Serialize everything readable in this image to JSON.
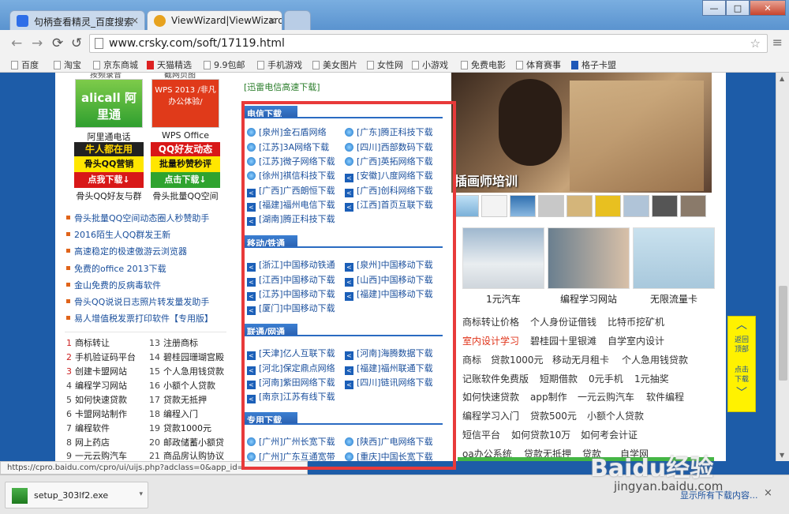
{
  "browser": {
    "tabs": [
      {
        "label": "句柄查看精灵_百度搜索",
        "active": false
      },
      {
        "label": "ViewWizard|ViewWizard",
        "active": true
      }
    ],
    "close_glyph": "×",
    "window_buttons": {
      "minimize": "—",
      "maximize": "□",
      "close": "✕"
    },
    "nav": {
      "back": "←",
      "forward": "→",
      "reload": "⟳",
      "stop": "↺"
    },
    "url": "www.crsky.com/soft/17119.html",
    "star_glyph": "☆",
    "menu_glyph": "≡",
    "bookmarks": [
      "百度",
      "淘宝",
      "京东商城",
      "天猫精选",
      "9.9包邮",
      "手机游戏",
      "美女图片",
      "女性网",
      "小游戏",
      "免费电影",
      "体育赛事",
      "格子卡盟"
    ]
  },
  "left": {
    "top_labels": [
      "按频录音",
      "截网页图"
    ],
    "apps": [
      {
        "img_text": "alicall 阿里通",
        "label": "阿里通电话"
      },
      {
        "img_text": "WPS 2013 /非凡办公体验/",
        "label": "WPS Office"
      },
      {
        "img_t1": "牛人都在用",
        "img_t2": "骨头QQ营销",
        "img_t3": "点我下载↓",
        "label": "骨头QQ好友与群"
      },
      {
        "img_t1": "QQ好友动态",
        "img_t2": "批量秒赞秒评",
        "img_t3": "点击下载↓",
        "label": "骨头批量QQ空间"
      }
    ],
    "links": [
      "骨头批量QQ空间动态圈人秒赞助手",
      "2016陌生人QQ群发王新",
      "高速稳定的极速傲游云浏览器",
      "免费的office 2013下载",
      "金山免费的反病毒软件",
      "骨头QQ说说日志照片转发量发助手",
      "易人增值税发票打印软件"
    ],
    "special_tag": "【专用版】",
    "ranks": [
      {
        "n": "1",
        "t": "商标转让"
      },
      {
        "n": "13",
        "t": "注册商标"
      },
      {
        "n": "2",
        "t": "手机验证码平台"
      },
      {
        "n": "14",
        "t": "碧桂园珊瑚宫殿"
      },
      {
        "n": "3",
        "t": "创建卡盟网站"
      },
      {
        "n": "15",
        "t": "个人急用钱贷款"
      },
      {
        "n": "4",
        "t": "编程学习网站"
      },
      {
        "n": "16",
        "t": "小额个人贷款"
      },
      {
        "n": "5",
        "t": "如何快速贷款"
      },
      {
        "n": "17",
        "t": "贷款无抵押"
      },
      {
        "n": "6",
        "t": "卡盟网站制作"
      },
      {
        "n": "18",
        "t": "编程入门"
      },
      {
        "n": "7",
        "t": "编程软件"
      },
      {
        "n": "19",
        "t": "贷款1000元"
      },
      {
        "n": "8",
        "t": "网上药店"
      },
      {
        "n": "20",
        "t": "邮政储蓄小额贷"
      },
      {
        "n": "9",
        "t": "一元云购汽车"
      },
      {
        "n": "21",
        "t": "商品房认购协议"
      }
    ]
  },
  "middle": {
    "top_link": "[迅雷电信高速下载]",
    "sections": [
      {
        "title": "电信下载",
        "links": [
          "[泉州]金石盾网络",
          "[广东]腾正科技下载",
          "[江苏]3A网络下载",
          "[四川]西部数码下载",
          "[江苏]微子网络下载",
          "[广西]英拓网络下载",
          "[徐州]祺信科技下载",
          "[安徽]八度网络下载",
          "[广西]广西朗恒下载",
          "[广西]创科网络下载",
          "[福建]福州电信下载",
          "[江西]首页互联下载",
          "[湖南]腾正科技下载"
        ]
      },
      {
        "title": "移动/铁通",
        "links": [
          "[浙江]中国移动铁通",
          "[泉州]中国移动下载",
          "[江西]中国移动下载",
          "[山西]中国移动下载",
          "[江苏]中国移动下载",
          "[福建]中国移动下载",
          "[厦门]中国移动下载"
        ]
      },
      {
        "title": "联通/网通",
        "links": [
          "[天津]亿人互联下载",
          "[河南]海腾数据下载",
          "[河北]保定鼎点网络",
          "[福建]福州联通下载",
          "[河南]紫田网络下载",
          "[四川]链讯网络下载",
          "[南京]江苏有线下载"
        ]
      },
      {
        "title": "专用下载",
        "links": [
          "[广州]广州长宽下载",
          "[陕西]广电网络下载",
          "[广州]广东互通宽带",
          "[重庆]中国长宽下载"
        ]
      }
    ],
    "bottom_label": "下载"
  },
  "right": {
    "photo_caption": "插画师培训",
    "cards": [
      "1元汽车",
      "编程学习网站",
      "无限流量卡"
    ],
    "keywords": [
      [
        "商标转让价格",
        "个人身份证借钱",
        "比特币挖矿机"
      ],
      [
        "室内设计学习",
        "碧桂园十里银滩",
        "自学室内设计"
      ],
      [
        "商标",
        "贷款1000元",
        "移动无月租卡",
        "个人急用钱贷款"
      ],
      [
        "记账软件免费版",
        "短期借款",
        "0元手机",
        "1元抽奖"
      ],
      [
        "如何快速贷款",
        "app制作",
        "一元云购汽车",
        "软件编程"
      ],
      [
        "编程学习入门",
        "贷款500元",
        "小额个人贷款"
      ],
      [
        "短信平台",
        "如何贷款10万",
        "如何考会计证"
      ],
      [
        "oa办公系统",
        "贷款无抵押",
        "贷款",
        "自学网"
      ]
    ],
    "red_keyword": "室内设计学习"
  },
  "float_btn": {
    "up_label": "返回顶部",
    "down_label": "点击下载",
    "up_arrow": "︿",
    "down_arrow": "﹀"
  },
  "status_url": "https://cpro.baidu.com/cpro/ui/uijs.php?adclass=0&app_id=",
  "download": {
    "file": "setup_303lf2.exe",
    "show_all": "显示所有下载内容...",
    "caret": "▾",
    "close": "×"
  },
  "watermark": {
    "main": "Baidu经验",
    "sub": "jingyan.baidu.com"
  },
  "colors": {
    "accent_red": "#e83a3a",
    "link_blue": "#1a4f9c",
    "float_yellow": "#fff200"
  }
}
